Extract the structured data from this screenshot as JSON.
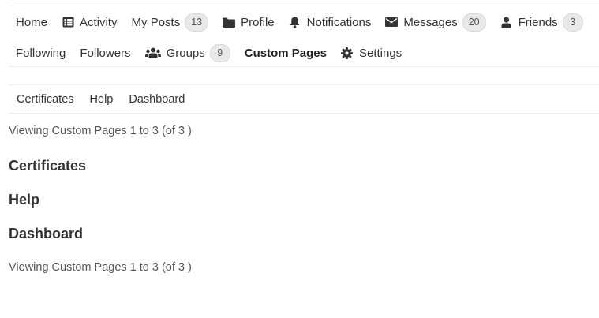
{
  "main_nav": {
    "row1": [
      {
        "label": "Home",
        "icon": null,
        "count": null
      },
      {
        "label": "Activity",
        "icon": "activity-list-icon",
        "count": null
      },
      {
        "label": "My Posts",
        "icon": null,
        "count": "13"
      },
      {
        "label": "Profile",
        "icon": "folder-icon",
        "count": null
      },
      {
        "label": "Notifications",
        "icon": "bell-icon",
        "count": null
      },
      {
        "label": "Messages",
        "icon": "envelope-icon",
        "count": "20"
      },
      {
        "label": "Friends",
        "icon": "user-icon",
        "count": "3"
      }
    ],
    "row2": [
      {
        "label": "Following",
        "icon": null,
        "count": null
      },
      {
        "label": "Followers",
        "icon": null,
        "count": null
      },
      {
        "label": "Groups",
        "icon": "users-group-icon",
        "count": "9"
      },
      {
        "label": "Custom Pages",
        "icon": null,
        "count": null,
        "active": true
      },
      {
        "label": "Settings",
        "icon": "gear-icon",
        "count": null
      }
    ]
  },
  "sub_nav": {
    "items": [
      "Certificates",
      "Help",
      "Dashboard"
    ]
  },
  "pagination": {
    "top": "Viewing Custom Pages 1 to 3 (of 3 )",
    "bottom": "Viewing Custom Pages 1 to 3 (of 3 )"
  },
  "pages": [
    "Certificates",
    "Help",
    "Dashboard"
  ],
  "colors": {
    "text": "#333333",
    "muted_text": "#555555",
    "badge_bg": "#e9e9e9",
    "border": "#eeeeee"
  }
}
